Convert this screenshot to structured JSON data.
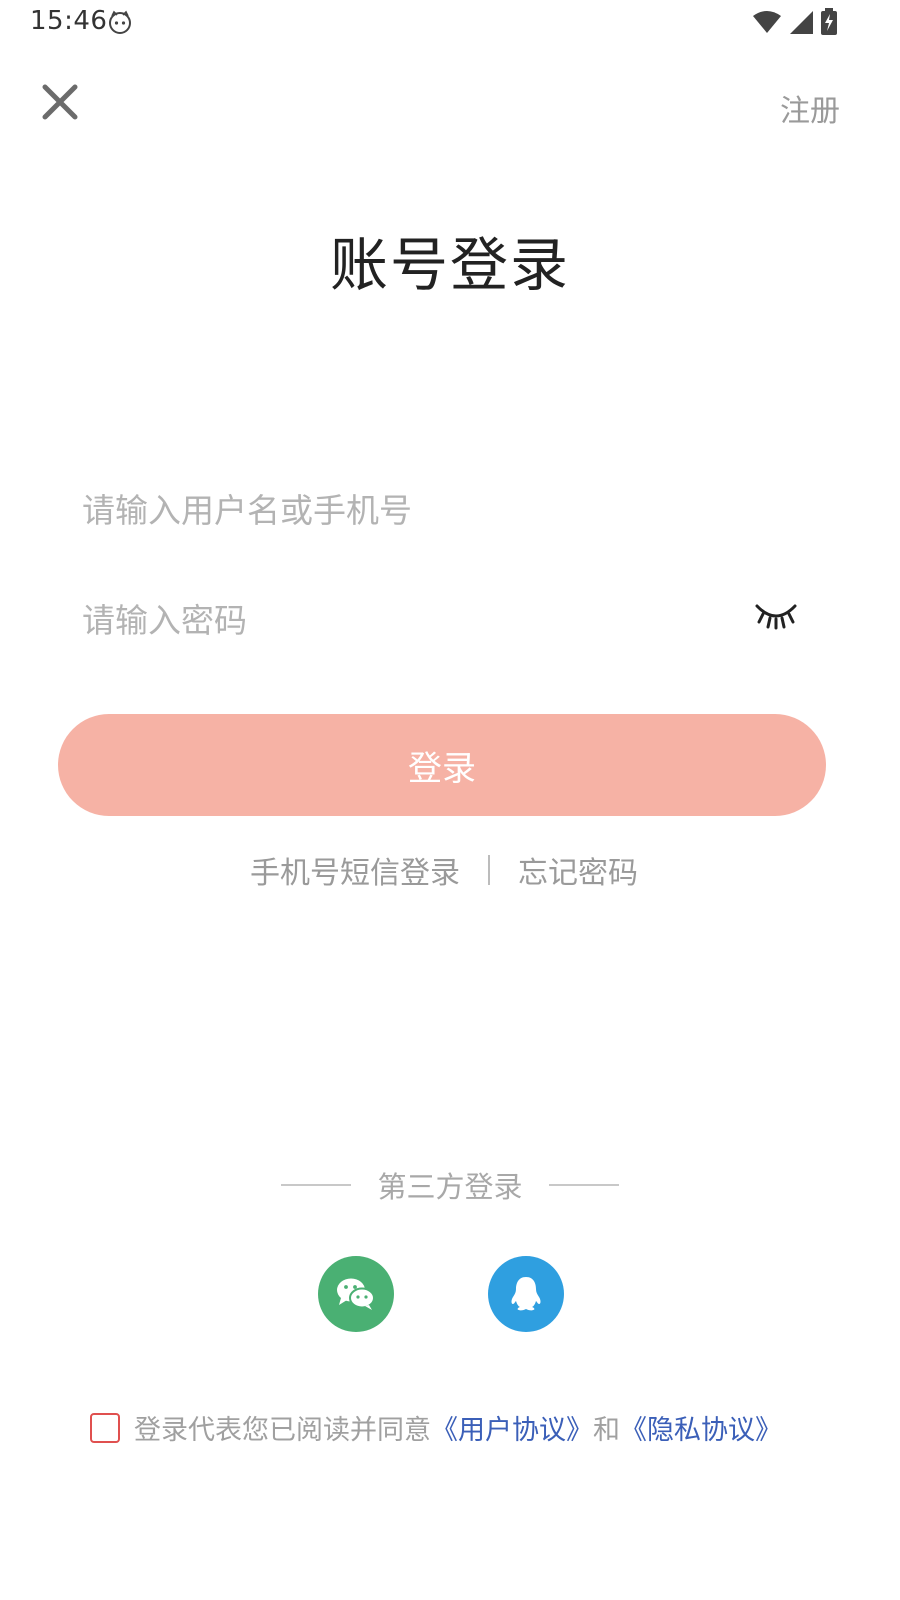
{
  "status_bar": {
    "time": "15:46"
  },
  "header": {
    "close_icon": "close-icon",
    "register_label": "注册"
  },
  "title": "账号登录",
  "form": {
    "username_placeholder": "请输入用户名或手机号",
    "username_value": "",
    "password_placeholder": "请输入密码",
    "password_value": "",
    "password_toggle_icon": "eye-closed-icon"
  },
  "login_button": {
    "label": "登录",
    "color": "#f6b2a5"
  },
  "alt_links": {
    "sms_login": "手机号短信登录",
    "forgot_password": "忘记密码"
  },
  "third_party": {
    "title": "第三方登录",
    "providers": [
      {
        "name": "wechat",
        "icon": "wechat-icon",
        "color": "#4ab073"
      },
      {
        "name": "qq",
        "icon": "qq-icon",
        "color": "#2f9fe0"
      }
    ]
  },
  "agreement": {
    "checked": false,
    "prefix": "登录代表您已阅读并同意",
    "user_agreement": "《用户协议》",
    "connector": "和",
    "privacy_agreement": "《隐私协议》",
    "link_color": "#3b5fb8"
  }
}
